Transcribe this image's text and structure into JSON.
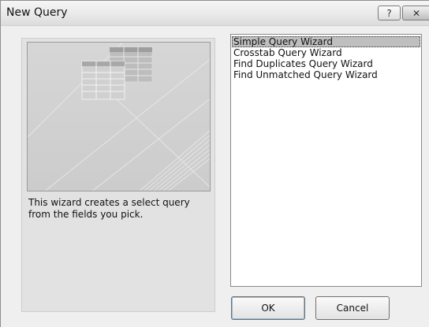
{
  "window": {
    "title": "New Query",
    "help_glyph": "?",
    "close_glyph": "✕"
  },
  "preview": {
    "description": "This wizard creates a select query from the fields you pick."
  },
  "wizard_list": {
    "items": [
      "Simple Query Wizard",
      "Crosstab Query Wizard",
      "Find Duplicates Query Wizard",
      "Find Unmatched Query Wizard"
    ],
    "selected": "Simple Query Wizard"
  },
  "buttons": {
    "ok": "OK",
    "cancel": "Cancel"
  }
}
